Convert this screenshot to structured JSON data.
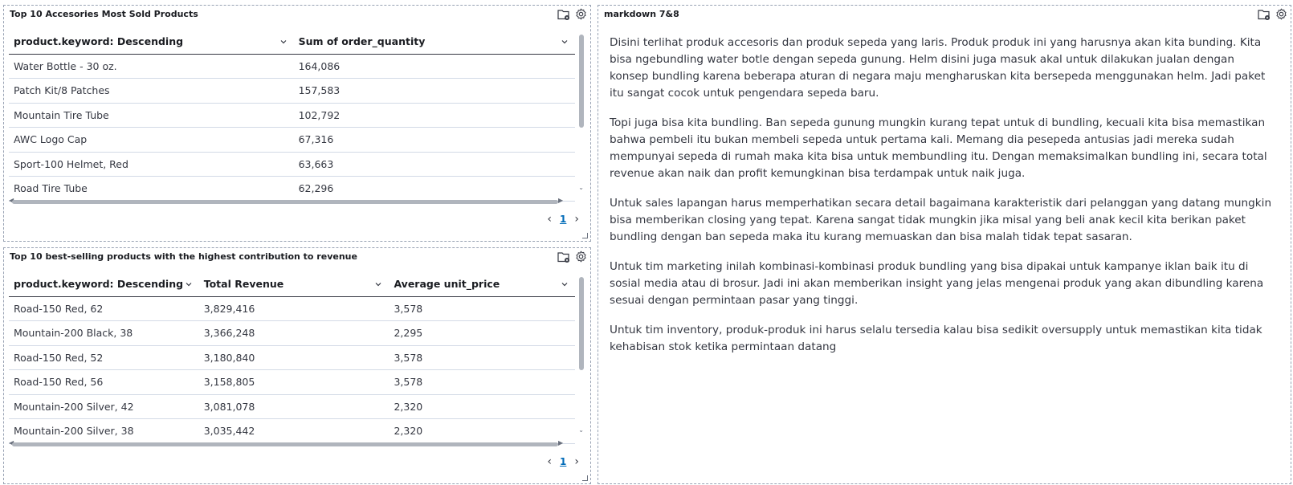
{
  "panels": {
    "accessories": {
      "title": "Top 10 Accesories Most Sold Products",
      "columns": [
        "product.keyword: Descending",
        "Sum of order_quantity"
      ],
      "rows": [
        [
          "Water Bottle - 30 oz.",
          "164,086"
        ],
        [
          "Patch Kit/8 Patches",
          "157,583"
        ],
        [
          "Mountain Tire Tube",
          "102,792"
        ],
        [
          "AWC Logo Cap",
          "67,316"
        ],
        [
          "Sport-100 Helmet, Red",
          "63,663"
        ],
        [
          "Road Tire Tube",
          "62,296"
        ]
      ],
      "page": "1"
    },
    "revenue": {
      "title": "Top 10 best-selling products with the highest contribution to revenue",
      "columns": [
        "product.keyword: Descending",
        "Total Revenue",
        "Average unit_price"
      ],
      "rows": [
        [
          "Road-150 Red, 62",
          "3,829,416",
          "3,578"
        ],
        [
          "Mountain-200 Black, 38",
          "3,366,248",
          "2,295"
        ],
        [
          "Road-150 Red, 52",
          "3,180,840",
          "3,578"
        ],
        [
          "Road-150 Red, 56",
          "3,158,805",
          "3,578"
        ],
        [
          "Mountain-200 Silver, 42",
          "3,081,078",
          "2,320"
        ],
        [
          "Mountain-200 Silver, 38",
          "3,035,442",
          "2,320"
        ]
      ],
      "page": "1"
    },
    "markdown": {
      "title": "markdown 7&8",
      "paragraphs": [
        "Disini terlihat produk accesoris dan produk sepeda yang laris. Produk produk ini yang harusnya akan kita bunding. Kita bisa ngebundling water botle dengan sepeda gunung. Helm disini juga masuk akal untuk dilakukan jualan dengan konsep bundling karena beberapa aturan di negara maju mengharuskan kita bersepeda menggunakan helm. Jadi paket itu sangat cocok untuk pengendara sepeda baru.",
        "Topi juga bisa kita bundling. Ban sepeda gunung mungkin kurang tepat untuk di bundling, kecuali kita bisa memastikan bahwa pembeli itu bukan membeli sepeda untuk pertama kali. Memang dia pesepeda antusias jadi mereka sudah mempunyai sepeda di rumah maka kita bisa untuk membundling itu. Dengan memaksimalkan bundling ini, secara total revenue akan naik dan profit kemungkinan bisa terdampak untuk naik juga.",
        "Untuk sales lapangan harus memperhatikan secara detail bagaimana karakteristik dari pelanggan yang datang mungkin bisa memberikan closing yang tepat. Karena sangat tidak mungkin jika misal yang beli anak kecil kita berikan paket bundling dengan ban sepeda maka itu kurang memuaskan dan bisa malah tidak tepat sasaran.",
        "Untuk tim marketing inilah kombinasi-kombinasi produk bundling yang bisa dipakai untuk kampanye iklan baik itu di sosial media atau di brosur. Jadi ini akan memberikan insight yang jelas mengenai produk yang akan dibundling karena sesuai dengan permintaan pasar yang tinggi.",
        "Untuk tim inventory, produk-produk ini harus selalu tersedia kalau bisa sedikit oversupply untuk memastikan kita tidak kehabisan stok ketika permintaan datang"
      ]
    }
  },
  "icons": [
    "inspect-icon",
    "gear-icon",
    "chevron-down-icon",
    "chevron-left-icon",
    "chevron-right-icon"
  ]
}
